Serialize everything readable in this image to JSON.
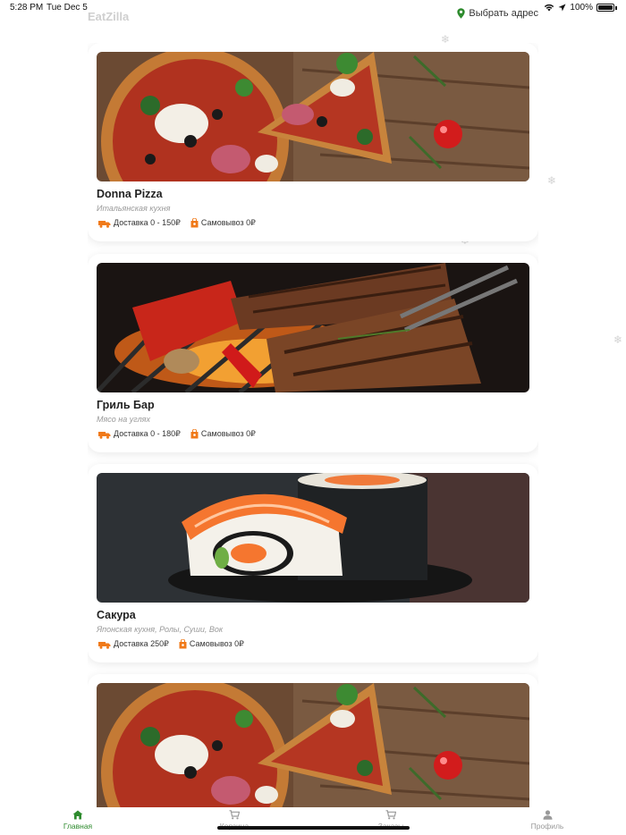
{
  "status_bar": {
    "time": "5:28 PM",
    "date": "Tue Dec 5",
    "battery": "100%"
  },
  "header": {
    "app_title": "EatZilla",
    "address_label": "Выбрать адрес"
  },
  "restaurants": [
    {
      "name": "Donna Pizza",
      "cuisine": "Итальянская кухня",
      "delivery": "Доставка 0 - 150₽",
      "pickup": "Самовывоз 0₽",
      "image": "pizza"
    },
    {
      "name": "Гриль Бар",
      "cuisine": "Мясо на углях",
      "delivery": "Доставка 0 - 180₽",
      "pickup": "Самовывоз 0₽",
      "image": "grill"
    },
    {
      "name": "Сакура",
      "cuisine": "Японская кухня, Ролы, Суши, Вок",
      "delivery": "Доставка 250₽",
      "pickup": "Самовывоз 0₽",
      "image": "sushi"
    },
    {
      "name": "",
      "cuisine": "",
      "delivery": "",
      "pickup": "",
      "image": "pizza"
    }
  ],
  "tabs": [
    {
      "label": "Главная",
      "icon": "home-icon",
      "active": true
    },
    {
      "label": "Корзина",
      "icon": "cart-icon",
      "active": false
    },
    {
      "label": "Заказы",
      "icon": "cart-icon",
      "active": false
    },
    {
      "label": "Профиль",
      "icon": "profile-icon",
      "active": false
    }
  ],
  "colors": {
    "accent": "#2e8b2e",
    "delivery_icon": "#f07a1a",
    "muted": "#9a9a9a"
  }
}
